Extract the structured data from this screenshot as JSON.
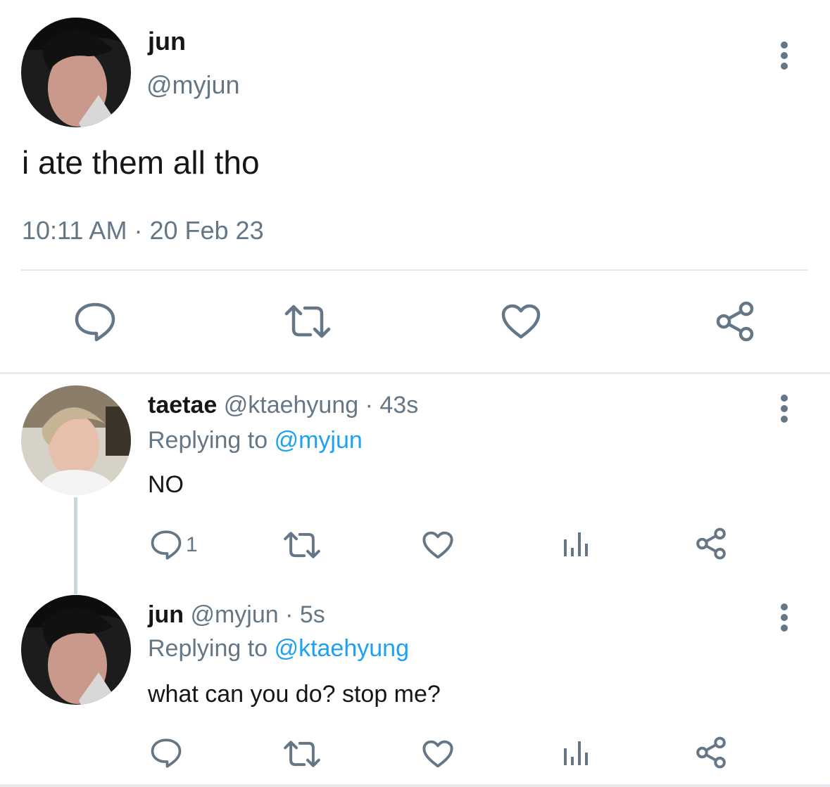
{
  "main_tweet": {
    "display_name": "jun",
    "handle": "@myjun",
    "text": "i ate them all tho",
    "time": "10:11 AM",
    "separator": "·",
    "date": "20 Feb 23"
  },
  "replies": [
    {
      "display_name": "taetae",
      "handle": "@ktaehyung",
      "separator": "·",
      "age": "43s",
      "replying_prefix": "Replying to",
      "replying_to": "@myjun",
      "text": "NO",
      "reply_count": "1"
    },
    {
      "display_name": "jun",
      "handle": "@myjun",
      "separator": "·",
      "age": "5s",
      "replying_prefix": "Replying to",
      "replying_to": "@ktaehyung",
      "text": "what can you do? stop me?",
      "reply_count": ""
    }
  ],
  "icons": {
    "reply": "reply-icon",
    "retweet": "retweet-icon",
    "like": "heart-icon",
    "analytics": "analytics-icon",
    "share": "share-icon",
    "more": "more-vertical-icon"
  },
  "colors": {
    "text": "#14171a",
    "secondary": "#657786",
    "link": "#1da1f2",
    "divider": "#e1e8ed"
  }
}
